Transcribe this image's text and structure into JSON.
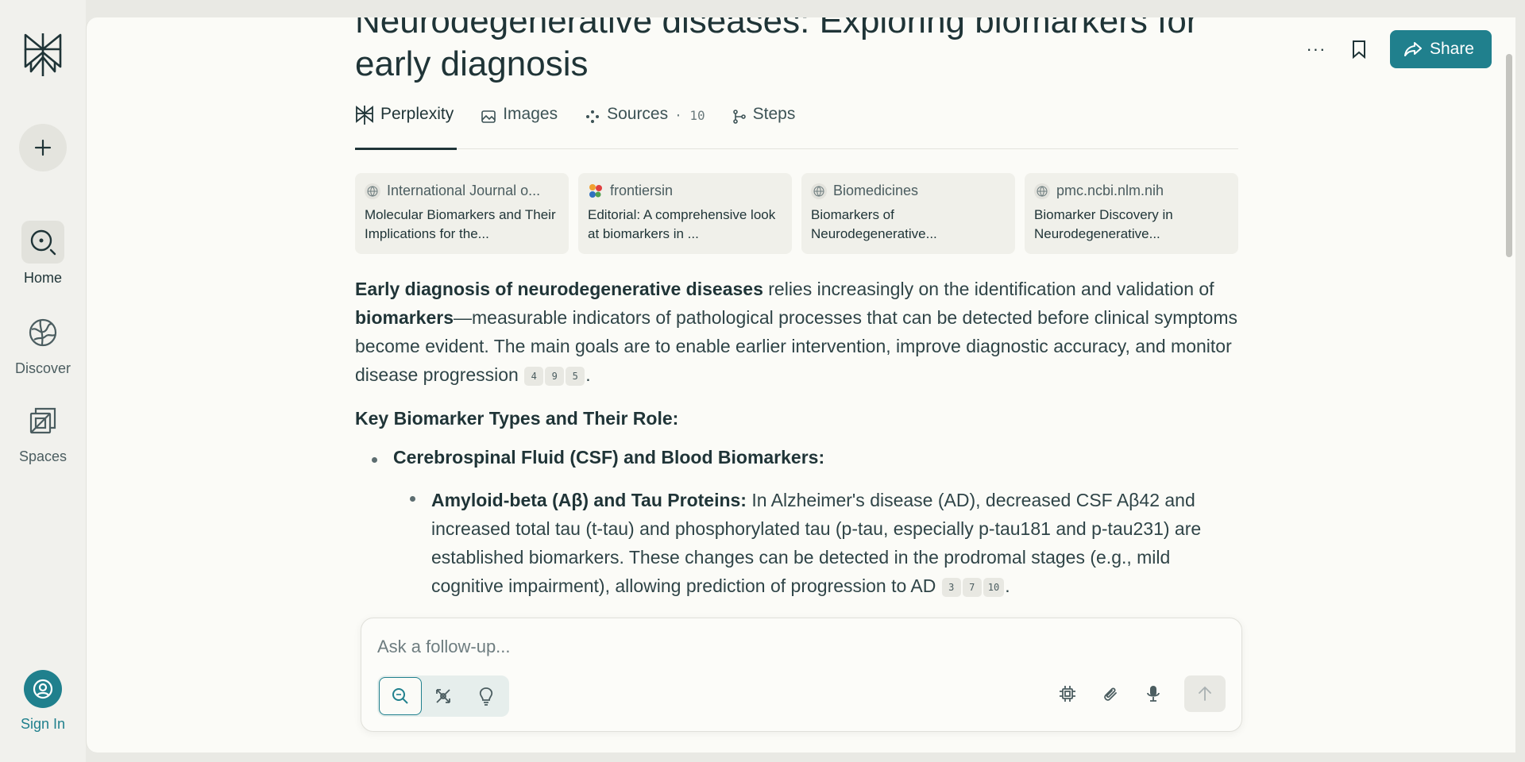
{
  "sidebar": {
    "new_label": "+",
    "items": [
      {
        "label": "Home",
        "icon": "home-search-icon"
      },
      {
        "label": "Discover",
        "icon": "globe-icon"
      },
      {
        "label": "Spaces",
        "icon": "spaces-icon"
      }
    ],
    "sign_in": "Sign In"
  },
  "header": {
    "more_label": "···",
    "share_label": "Share"
  },
  "thread": {
    "title": "Neurodegenerative diseases: Exploring biomarkers for early diagnosis",
    "tabs": [
      {
        "label": "Perplexity",
        "active": true
      },
      {
        "label": "Images"
      },
      {
        "label": "Sources",
        "count": "· 10"
      },
      {
        "label": "Steps"
      }
    ],
    "sources": [
      {
        "site": "International Journal o...",
        "title": "Molecular Biomarkers and Their Implications for the..."
      },
      {
        "site": "frontiersin",
        "title": "Editorial: A comprehensive look at biomarkers in ..."
      },
      {
        "site": "Biomedicines",
        "title": "Biomarkers of Neurodegenerative..."
      },
      {
        "site": "pmc.ncbi.nlm.nih",
        "title": "Biomarker Discovery in Neurodegenerative..."
      }
    ],
    "answer": {
      "p1_bold1": "Early diagnosis of neurodegenerative diseases",
      "p1_text1": " relies increasingly on the identification and validation of ",
      "p1_bold2": "biomarkers",
      "p1_text2": "—measurable indicators of pathological processes that can be detected before clinical symptoms become evident. The main goals are to enable earlier intervention, improve diagnostic accuracy, and monitor disease progression",
      "p1_cites": [
        "4",
        "9",
        "5"
      ],
      "heading": "Key Biomarker Types and Their Role:",
      "bullet1": "Cerebrospinal Fluid (CSF) and Blood Biomarkers:",
      "bullet2_bold": "Amyloid-beta (Aβ) and Tau Proteins:",
      "bullet2_text": " In Alzheimer's disease (AD), decreased CSF Aβ42 and increased total tau (t-tau) and phosphorylated tau (p-tau, especially p-tau181 and p-tau231) are established biomarkers. These changes can be detected in the prodromal stages (e.g., mild cognitive impairment), allowing prediction of progression to AD",
      "bullet2_cites": [
        "3",
        "7",
        "10"
      ]
    }
  },
  "composer": {
    "placeholder": "Ask a follow-up..."
  },
  "colors": {
    "accent": "#20808d",
    "text": "#1f3437",
    "background": "#fbfbf7"
  }
}
